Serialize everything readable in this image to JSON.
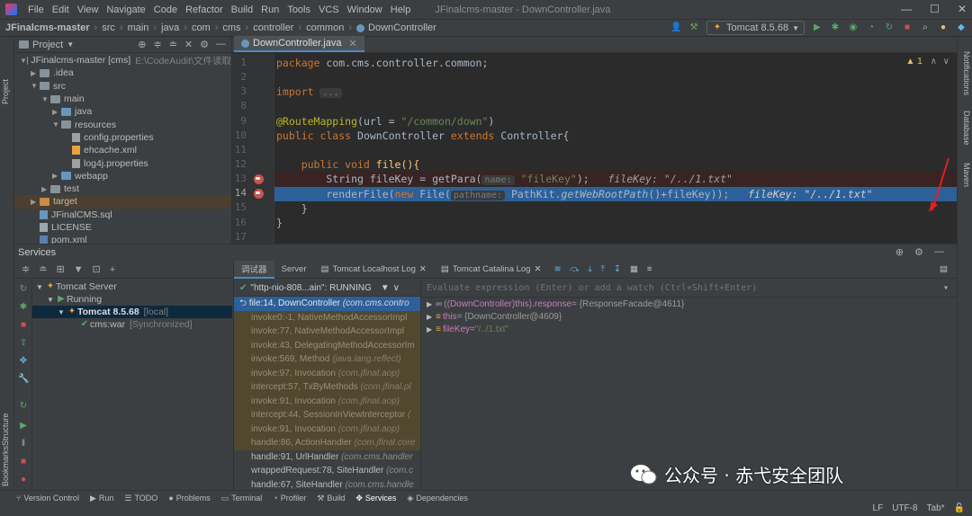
{
  "menu": {
    "items": [
      "File",
      "Edit",
      "View",
      "Navigate",
      "Code",
      "Refactor",
      "Build",
      "Run",
      "Tools",
      "VCS",
      "Window",
      "Help"
    ],
    "window_title": "JFinalcms-master - DownController.java"
  },
  "navbar": {
    "crumbs": [
      "JFinalcms-master",
      "src",
      "main",
      "java",
      "com",
      "cms",
      "controller",
      "common",
      "DownController"
    ],
    "run_config": "Tomcat 8.5.68"
  },
  "left_strip": {
    "project": "Project",
    "structure": "Structure",
    "bookmarks": "Bookmarks"
  },
  "right_strip": {
    "notifications": "Notifications",
    "database": "Database",
    "maven": "Maven"
  },
  "project": {
    "title": "Project",
    "root": {
      "name": "JFinalcms-master [cms]",
      "path": "E:\\CodeAudit\\文件读取"
    },
    "nodes": [
      ".idea",
      "src",
      "main",
      "java",
      "resources",
      "config.properties",
      "ehcache.xml",
      "log4j.properties",
      "webapp",
      "test",
      "target",
      "JFinalCMS.sql",
      "LICENSE",
      "pom.xml"
    ]
  },
  "editor": {
    "tab": "DownController.java",
    "warning": "1",
    "line_numbers": [
      "1",
      "2",
      "3",
      "8",
      "9",
      "10",
      "11",
      "12",
      "13",
      "14",
      "15",
      "16",
      "17"
    ],
    "code": {
      "pkg_kw": "package",
      "pkg_rest": " com.cms.controller.common;",
      "imp_kw": "import",
      "imp_rest": "...",
      "ann": "@RouteMapping",
      "ann_args_a": "(url = ",
      "ann_str": "\"/common/down\"",
      "ann_args_b": ")",
      "cls_kw": "public class",
      "cls_name": " DownController ",
      "ext_kw": "extends",
      "ext_rest": " Controller{",
      "m_kw": "    public void",
      "m_rest": " file(){",
      "l13_a": "        String fileKey = getPara(",
      "l13_hint": "name:",
      "l13_str": "\"fileKey\"",
      "l13_b": ");",
      "l13_dbg": "fileKey: \"/../1.txt\"",
      "l14_a": "        renderFile(",
      "l14_kw": "new",
      "l14_b": " File(",
      "l14_hint": "pathname:",
      "l14_c": " PathKit.",
      "l14_fn": "getWebRootPath",
      "l14_d": "()+fileKey));",
      "l14_dbg": "fileKey: \"/../1.txt\"",
      "close1": "    }",
      "close2": "}"
    }
  },
  "services": {
    "title": "Services",
    "tree": {
      "server": "Tomcat Server",
      "running": "Running",
      "tomcat": "Tomcat 8.5.68",
      "tomcat_tag": "[local]",
      "war": "cms:war",
      "war_tag": "[Synchronized]"
    }
  },
  "debugger": {
    "tabs": [
      "调试器",
      "Server",
      "Tomcat Localhost Log",
      "Tomcat Catalina Log"
    ],
    "thread": "\"http-nio-808...ain\": RUNNING",
    "frames": [
      {
        "m": "file:14, DownController",
        "p": "(com.cms.contro",
        "cls": "cur"
      },
      {
        "m": "invoke0:-1, NativeMethodAccessorImpl",
        "p": "",
        "cls": "lib"
      },
      {
        "m": "invoke:77, NativeMethodAccessorImpl",
        "p": "",
        "cls": "lib"
      },
      {
        "m": "invoke:43, DelegatingMethodAccessorIm",
        "p": "",
        "cls": "lib"
      },
      {
        "m": "invoke:569, Method",
        "p": "(java.lang.reflect)",
        "cls": "lib"
      },
      {
        "m": "invoke:97, Invocation",
        "p": "(com.jfinal.aop)",
        "cls": "lib"
      },
      {
        "m": "intercept:57, TxByMethods",
        "p": "(com.jfinal.pl",
        "cls": "lib"
      },
      {
        "m": "invoke:91, Invocation",
        "p": "(com.jfinal.aop)",
        "cls": "lib"
      },
      {
        "m": "intercept:44, SessionInViewInterceptor",
        "p": "(",
        "cls": "lib"
      },
      {
        "m": "invoke:91, Invocation",
        "p": "(com.jfinal.aop)",
        "cls": "lib"
      },
      {
        "m": "handle:86, ActionHandler",
        "p": "(com.jfinal.core",
        "cls": "lib"
      },
      {
        "m": "handle:91, UrlHandler",
        "p": "(com.cms.handler",
        "cls": ""
      },
      {
        "m": "wrappedRequest:78, SiteHandler",
        "p": "(com.c",
        "cls": ""
      },
      {
        "m": "handle:67, SiteHandler",
        "p": "(com.cms.handle",
        "cls": ""
      }
    ],
    "eval_placeholder": "Evaluate expression (Enter) or add a watch (Ctrl+Shift+Enter)",
    "vars": [
      {
        "name": "((DownController)this).response",
        "val": " = {ResponseFacade@4611}",
        "str": ""
      },
      {
        "name": "this",
        "val": " = {DownController@4609}",
        "str": ""
      },
      {
        "name": "fileKey",
        "val": " = ",
        "str": "\"/../1.txt\""
      }
    ]
  },
  "bottom_tabs": [
    "Version Control",
    "Run",
    "TODO",
    "Problems",
    "Terminal",
    "Profiler",
    "Build",
    "Services",
    "Dependencies"
  ],
  "status": {
    "lf": "LF",
    "enc": "UTF-8",
    "tab": "Tab*"
  },
  "watermark": "公众号 · 赤弋安全团队"
}
